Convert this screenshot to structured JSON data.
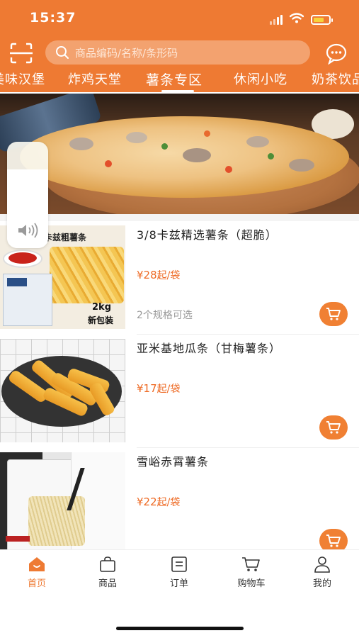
{
  "status_bar": {
    "time": "15:37"
  },
  "search": {
    "placeholder": "商品编码/名称/条形码"
  },
  "icons": {
    "scan": "scan-icon",
    "search": "search-icon",
    "message": "message-icon",
    "volume": "speaker-icon",
    "cart": "cart-icon"
  },
  "category_tabs": [
    {
      "label": "美味汉堡"
    },
    {
      "label": "炸鸡天堂"
    },
    {
      "label": "薯条专区",
      "active": true
    },
    {
      "label": "休闲小吃"
    },
    {
      "label": "奶茶饮品"
    }
  ],
  "products": [
    {
      "name": "3/8卡兹精选薯条（超脆）",
      "price": "¥28",
      "unit": "起/袋",
      "spec": "2个规格可选",
      "thumb_text_top": "卡兹粗薯条",
      "thumb_text_weight": "2kg",
      "thumb_text_badge": "新包装"
    },
    {
      "name": "亚米基地瓜条（甘梅薯条）",
      "price": "¥17",
      "unit": "起/袋",
      "spec": ""
    },
    {
      "name": "雪峪赤霄薯条",
      "price": "¥22",
      "unit": "起/袋",
      "spec": ""
    }
  ],
  "bottom_nav": [
    {
      "label": "首页",
      "icon": "home-icon",
      "active": true
    },
    {
      "label": "商品",
      "icon": "bag-icon"
    },
    {
      "label": "订单",
      "icon": "order-icon"
    },
    {
      "label": "购物车",
      "icon": "cart-icon"
    },
    {
      "label": "我的",
      "icon": "user-icon"
    }
  ],
  "colors": {
    "brand": "#ee7a33",
    "price": "#ee6a24",
    "search_bg": "#f3a26f"
  }
}
